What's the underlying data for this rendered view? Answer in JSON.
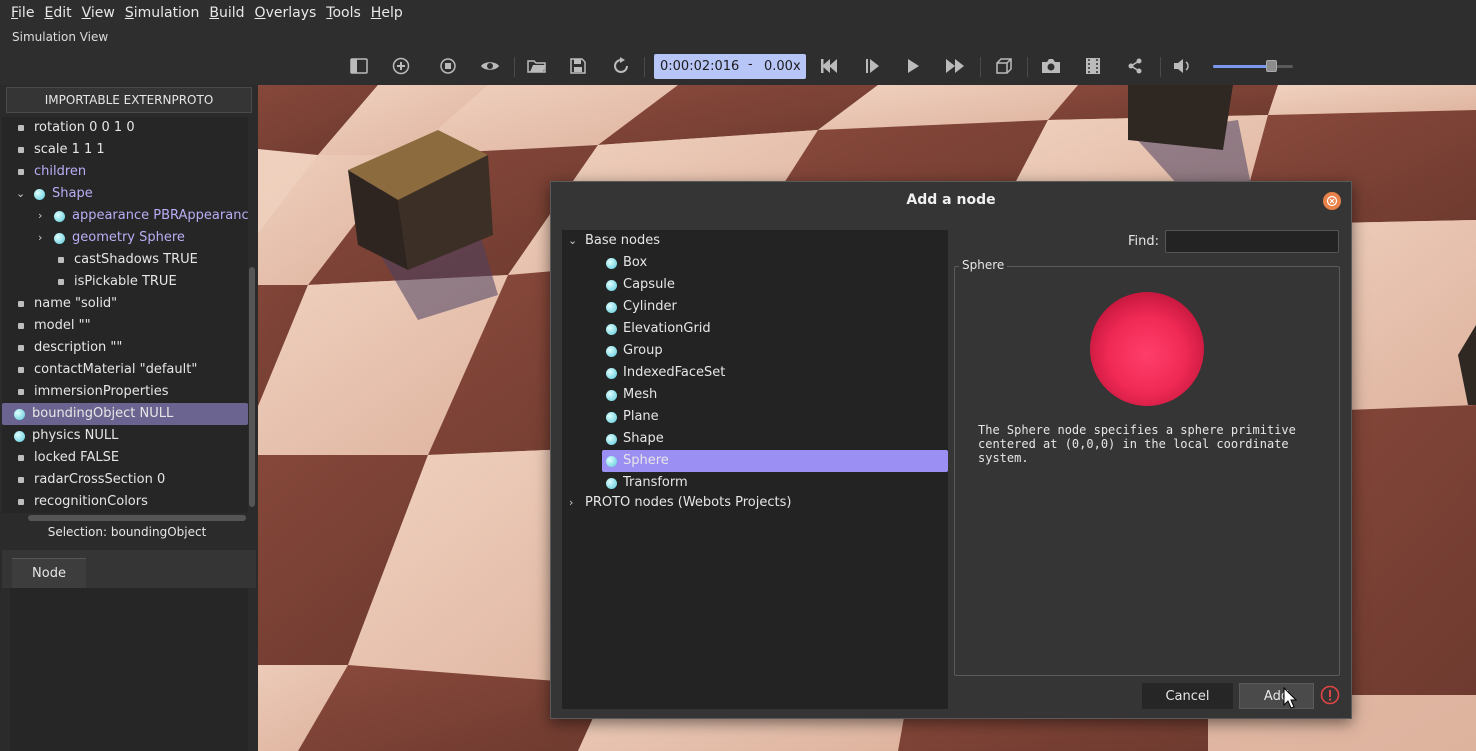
{
  "menu": {
    "items": [
      {
        "label": "File",
        "mnemonic": "F",
        "rest": "ile"
      },
      {
        "label": "Edit",
        "mnemonic": "E",
        "rest": "dit"
      },
      {
        "label": "View",
        "mnemonic": "V",
        "rest": "iew"
      },
      {
        "label": "Simulation",
        "mnemonic": "S",
        "rest": "imulation"
      },
      {
        "label": "Build",
        "mnemonic": "B",
        "rest": "uild"
      },
      {
        "label": "Overlays",
        "mnemonic": "O",
        "rest": "verlays"
      },
      {
        "label": "Tools",
        "mnemonic": "T",
        "rest": "ools"
      },
      {
        "label": "Help",
        "mnemonic": "H",
        "rest": "elp"
      }
    ]
  },
  "view_title": "Simulation View",
  "toolbar": {
    "time": "0:00:02:016",
    "time_separator": "-",
    "speed": "0.00x",
    "volume_level": 0.72
  },
  "left_panel": {
    "importable_button": "IMPORTABLE EXTERNPROTO",
    "tree": [
      {
        "label": "rotation 0 0 1 0",
        "kind": "field"
      },
      {
        "label": "scale 1 1 1",
        "kind": "field"
      },
      {
        "label": "children",
        "kind": "proto-field"
      },
      {
        "label": "Shape",
        "kind": "node"
      },
      {
        "label": "appearance PBRAppearance",
        "kind": "node"
      },
      {
        "label": "geometry Sphere",
        "kind": "node"
      },
      {
        "label": "castShadows TRUE",
        "kind": "field"
      },
      {
        "label": "isPickable TRUE",
        "kind": "field"
      },
      {
        "label": "name \"solid\"",
        "kind": "field"
      },
      {
        "label": "model \"\"",
        "kind": "field"
      },
      {
        "label": "description \"\"",
        "kind": "field"
      },
      {
        "label": "contactMaterial \"default\"",
        "kind": "field"
      },
      {
        "label": "immersionProperties",
        "kind": "field"
      },
      {
        "label": "boundingObject NULL",
        "kind": "node"
      },
      {
        "label": "physics NULL",
        "kind": "node"
      },
      {
        "label": "locked FALSE",
        "kind": "field"
      },
      {
        "label": "radarCrossSection 0",
        "kind": "field"
      },
      {
        "label": "recognitionColors",
        "kind": "field"
      }
    ],
    "selection_label": "Selection: boundingObject",
    "node_tab": "Node"
  },
  "dialog": {
    "title": "Add a node",
    "tree": {
      "base_nodes_label": "Base nodes",
      "base_nodes": [
        "Box",
        "Capsule",
        "Cylinder",
        "ElevationGrid",
        "Group",
        "IndexedFaceSet",
        "Mesh",
        "Plane",
        "Shape",
        "Sphere",
        "Transform"
      ],
      "selected": "Sphere",
      "proto_nodes_label": "PROTO nodes (Webots Projects)"
    },
    "find_label": "Find:",
    "find_value": "",
    "preview_title": "Sphere",
    "description": "The Sphere node specifies a sphere primitive\ncentered at (0,0,0) in the local coordinate\nsystem.",
    "cancel_label": "Cancel",
    "add_label": "Add",
    "colors": {
      "selection": "#9b8ff3",
      "sphere": "#f02a55",
      "warning": "#e04444",
      "close": "#e9824a"
    }
  }
}
